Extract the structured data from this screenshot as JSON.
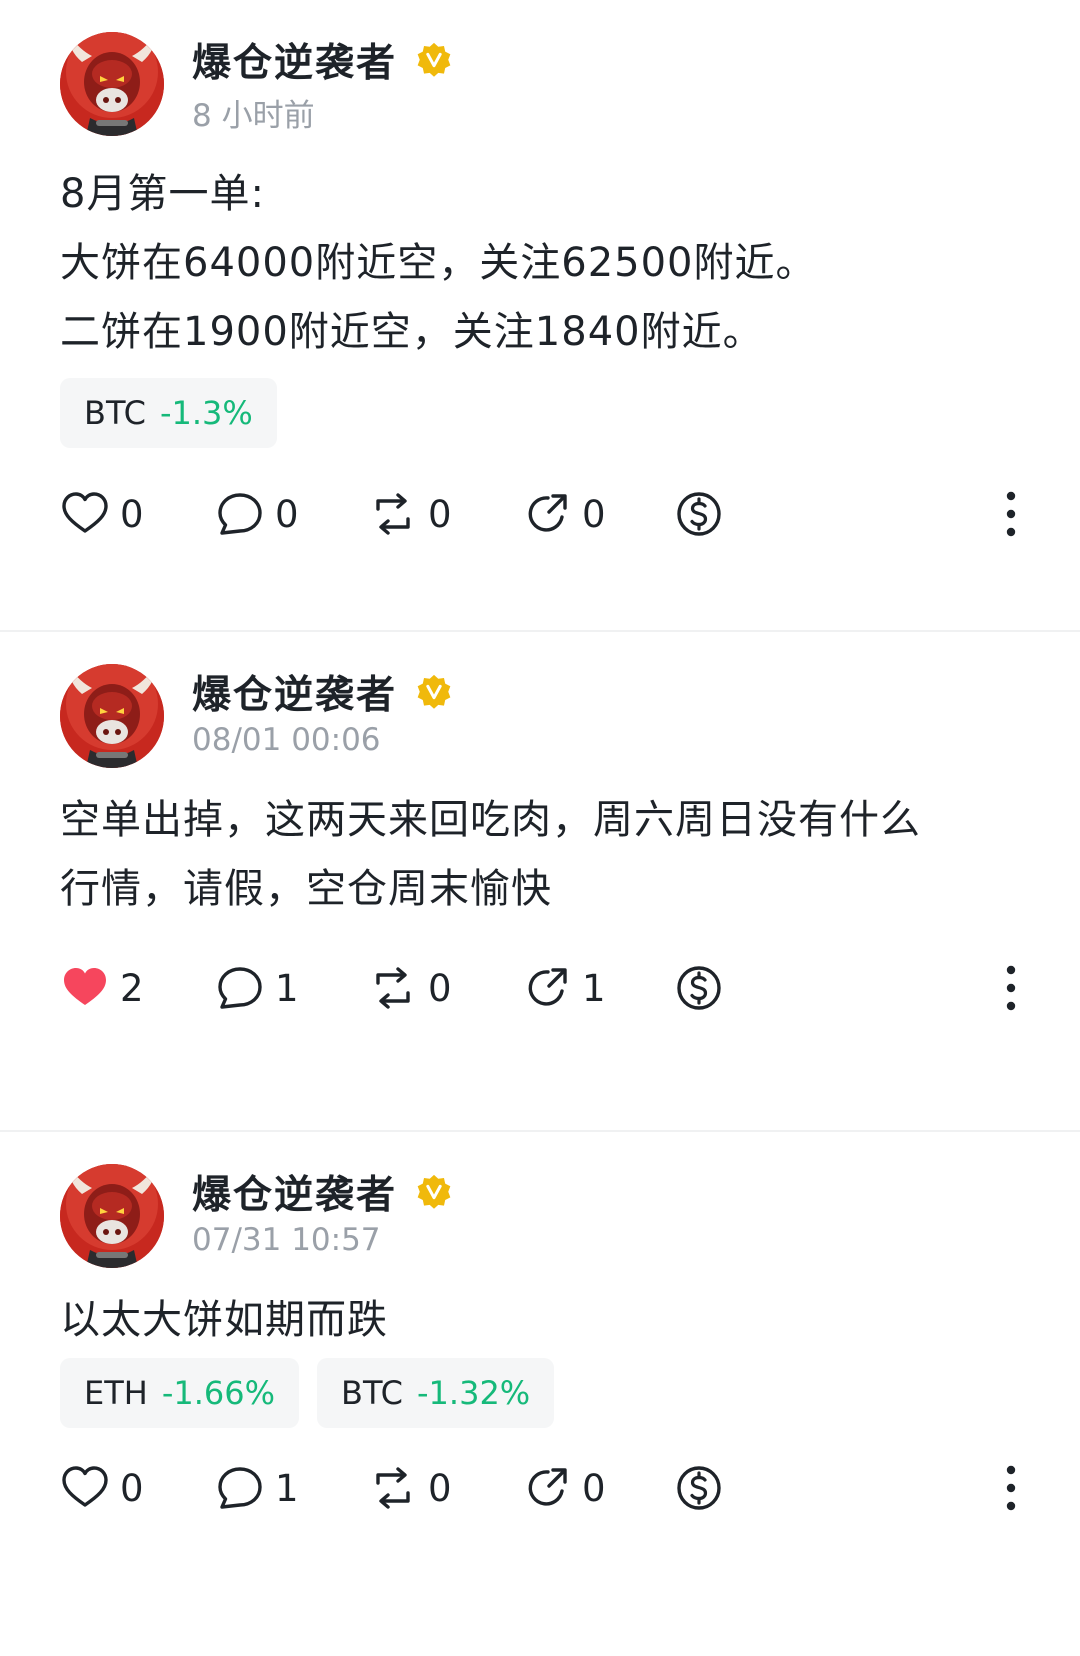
{
  "colors": {
    "text": "#1e2329",
    "muted": "#9aa0a8",
    "positive_change": "#16b97a",
    "liked_heart": "#f6465d",
    "verified_badge": "#f0b90b",
    "tag_bg": "#f5f6f7"
  },
  "posts": [
    {
      "author": "爆仓逆袭者",
      "verified": true,
      "time": "8 小时前",
      "lines": [
        "8月第一单:",
        "大饼在64000附近空，关注62500附近。",
        "二饼在1900附近空，关注1840附近。"
      ],
      "tags": [
        {
          "symbol": "BTC",
          "change": "-1.3%"
        }
      ],
      "actions": {
        "likes": "0",
        "liked": false,
        "comments": "0",
        "reposts": "0",
        "shares": "0"
      },
      "icons": [
        "heart-icon",
        "comment-icon",
        "repost-icon",
        "share-icon",
        "tip-dollar-icon",
        "more-vertical-icon"
      ]
    },
    {
      "author": "爆仓逆袭者",
      "verified": true,
      "time": "08/01 00:06",
      "lines": [
        "空单出掉，这两天来回吃肉，周六周日没有什么",
        "行情，请假，空仓周末愉快"
      ],
      "tags": [],
      "actions": {
        "likes": "2",
        "liked": true,
        "comments": "1",
        "reposts": "0",
        "shares": "1"
      },
      "icons": [
        "heart-filled-icon",
        "comment-icon",
        "repost-icon",
        "share-icon",
        "tip-dollar-icon",
        "more-vertical-icon"
      ]
    },
    {
      "author": "爆仓逆袭者",
      "verified": true,
      "time": "07/31 10:57",
      "lines": [
        "以太大饼如期而跌"
      ],
      "tags": [
        {
          "symbol": "ETH",
          "change": "-1.66%"
        },
        {
          "symbol": "BTC",
          "change": "-1.32%"
        }
      ],
      "actions": {
        "likes": "0",
        "liked": false,
        "comments": "1",
        "reposts": "0",
        "shares": "0"
      },
      "icons": [
        "heart-icon",
        "comment-icon",
        "repost-icon",
        "share-icon",
        "tip-dollar-icon",
        "more-vertical-icon"
      ]
    }
  ]
}
